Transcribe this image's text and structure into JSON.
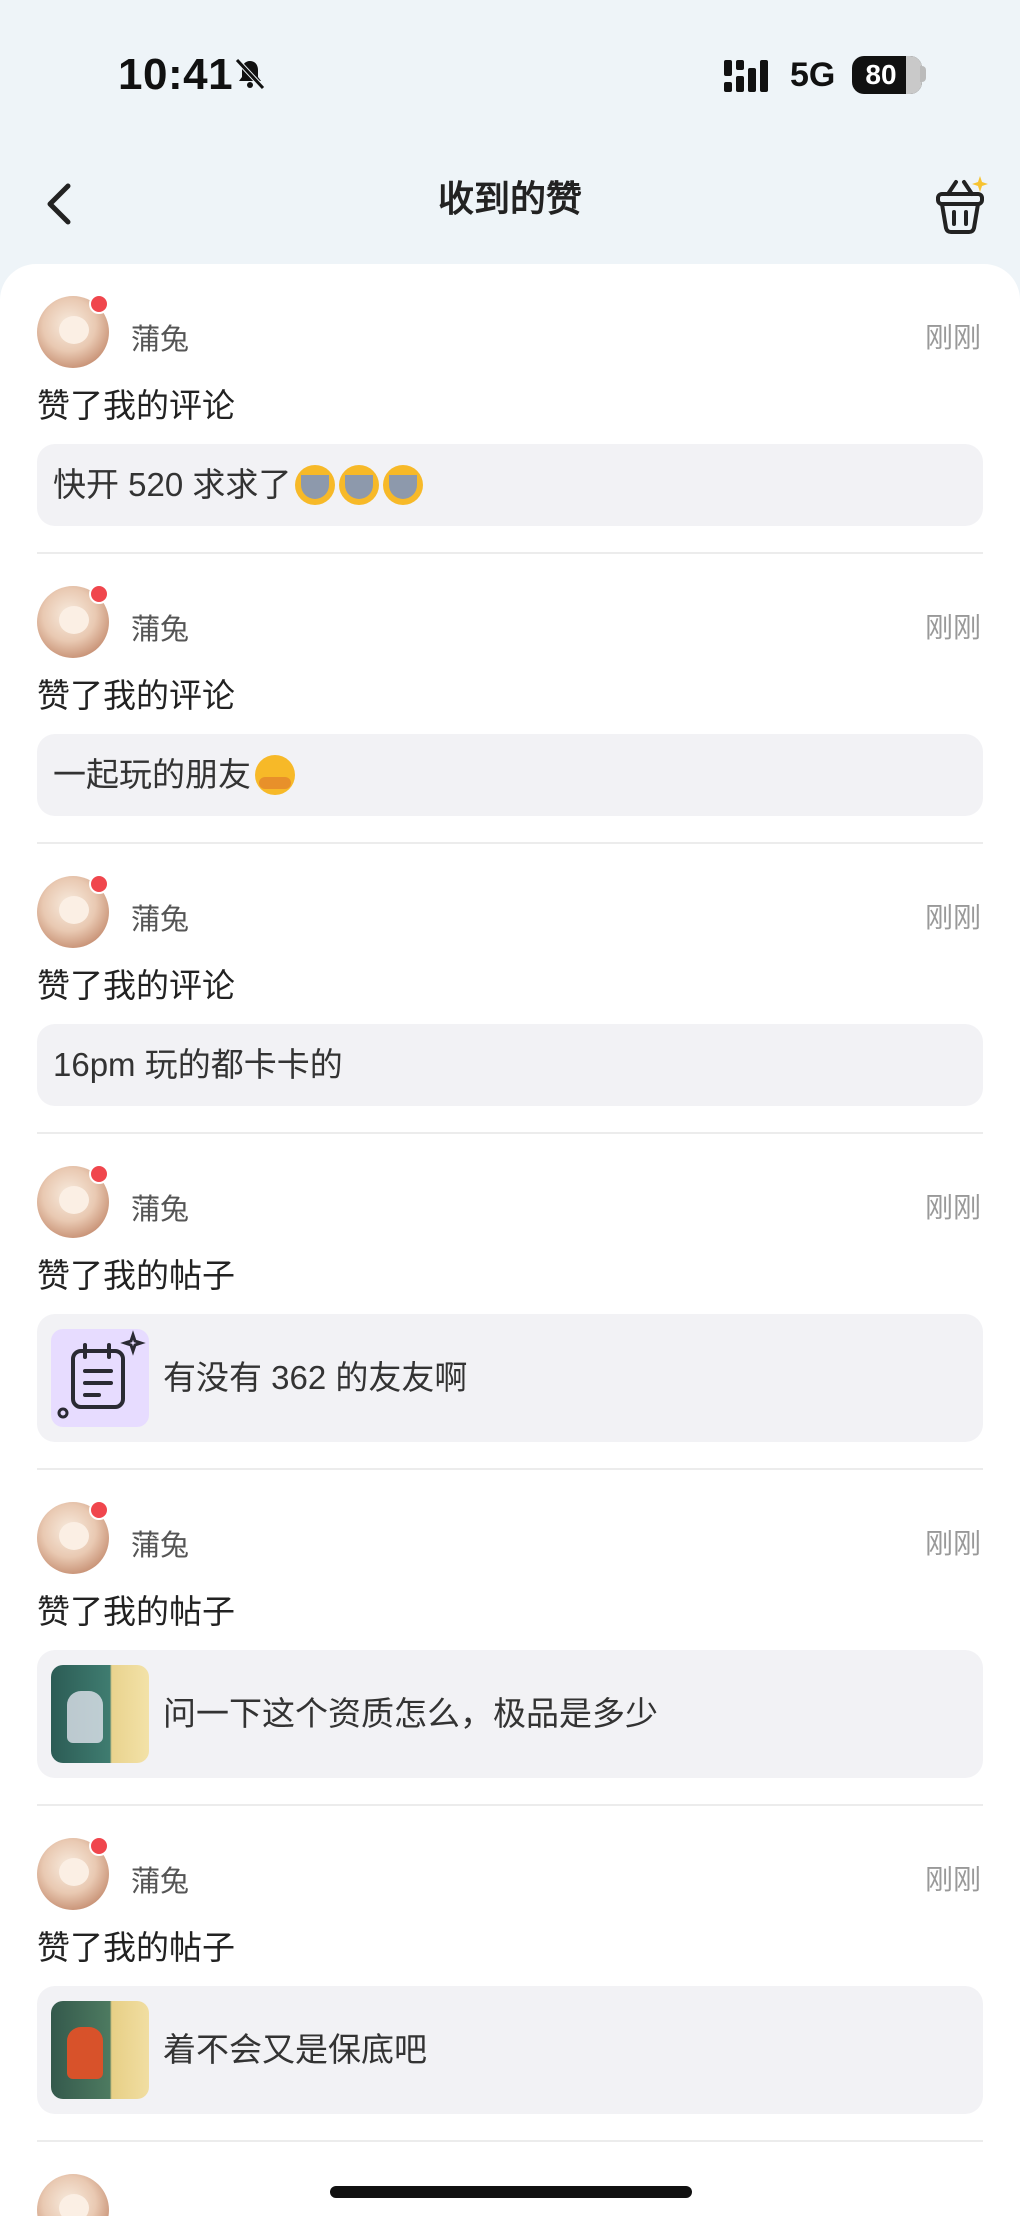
{
  "status_bar": {
    "time": "10:41",
    "network": "5G",
    "battery": "80"
  },
  "nav": {
    "title": "收到的赞"
  },
  "items": [
    {
      "user": "蒲兔",
      "time": "刚刚",
      "action": "赞了我的评论",
      "quote": "快开 520 求求了",
      "thumb": "none",
      "emoji": [
        "cry-emoji",
        "cry-emoji",
        "cry-emoji"
      ]
    },
    {
      "user": "蒲兔",
      "time": "刚刚",
      "action": "赞了我的评论",
      "quote": "一起玩的朋友",
      "thumb": "none",
      "emoji": [
        "hug-emoji"
      ]
    },
    {
      "user": "蒲兔",
      "time": "刚刚",
      "action": "赞了我的评论",
      "quote": "16pm 玩的都卡卡的",
      "thumb": "none",
      "emoji": []
    },
    {
      "user": "蒲兔",
      "time": "刚刚",
      "action": "赞了我的帖子",
      "quote": "有没有 362 的友友啊",
      "thumb": "note",
      "emoji": []
    },
    {
      "user": "蒲兔",
      "time": "刚刚",
      "action": "赞了我的帖子",
      "quote": "问一下这个资质怎么，极品是多少",
      "thumb": "game1",
      "emoji": []
    },
    {
      "user": "蒲兔",
      "time": "刚刚",
      "action": "赞了我的帖子",
      "quote": "着不会又是保底吧",
      "thumb": "game2",
      "emoji": []
    }
  ],
  "colors": {
    "background": "#eef4f8",
    "card": "#ffffff",
    "quote_bg": "#f2f2f5",
    "badge_red": "#f0464d",
    "time_gray": "#999999"
  }
}
